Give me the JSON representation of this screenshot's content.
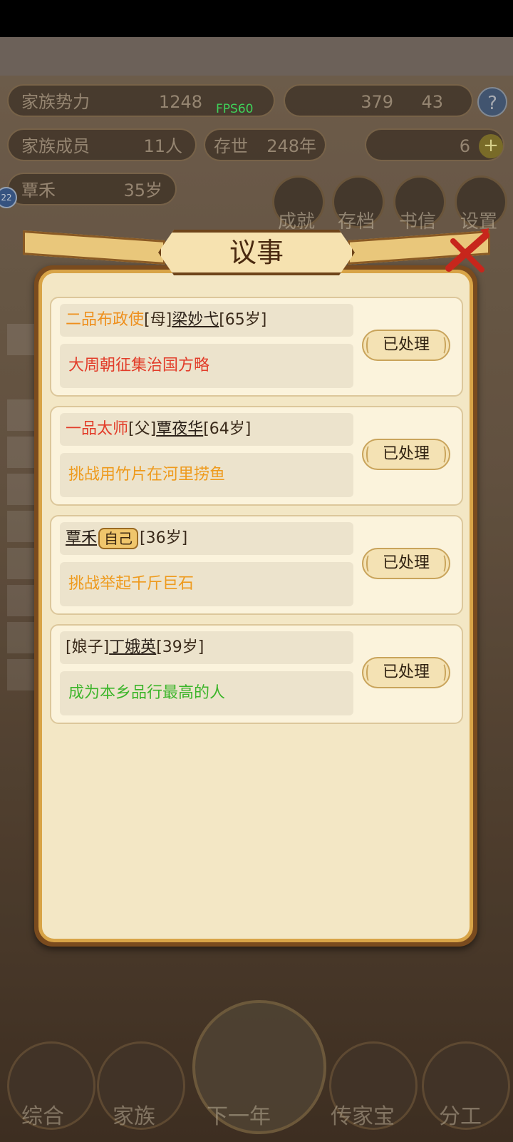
{
  "hud": {
    "clan_power_label": "家族势力",
    "clan_power_value": "1248",
    "resource_a": "379",
    "resource_b": "43",
    "help_label": "?",
    "members_label": "家族成员",
    "members_value": "11人",
    "exist_label": "存世",
    "exist_value": "248年",
    "gold_value": "6",
    "char_name": "覃禾",
    "char_age": "35岁",
    "level_badge": "22",
    "fps": "FPS60"
  },
  "top_menu": [
    {
      "label": "成就"
    },
    {
      "label": "存档"
    },
    {
      "label": "书信"
    },
    {
      "label": "设置"
    }
  ],
  "bottom_nav": {
    "general": "综合",
    "family": "家族",
    "next_year": "下一年",
    "heirloom": "传家宝",
    "division": "分工"
  },
  "dialog": {
    "title": "议事",
    "done_label": "已处理",
    "items": [
      {
        "rank": "二品布政使",
        "relation": "[母]",
        "name": "梁妙弋",
        "age": "[65岁]",
        "task": "大周朝征集治国方略"
      },
      {
        "rank": "一品太师",
        "relation": "[父]",
        "name": "覃夜华",
        "age": "[64岁]",
        "task": "挑战用竹片在河里捞鱼"
      },
      {
        "rank": "",
        "relation": "",
        "name": "覃禾",
        "self_badge": "自己",
        "age": "[36岁]",
        "task": "挑战举起千斤巨石"
      },
      {
        "rank": "",
        "relation": "[娘子]",
        "name": "丁娥英",
        "age": "[39岁]",
        "task": "成为本乡品行最高的人"
      }
    ]
  },
  "colors": {
    "rank_orange": "#ee8f1c",
    "rank_red": "#e23d2a",
    "task_green": "#3cb52a",
    "dialog_bg": "#f3e7c5",
    "dialog_border": "#d8a447"
  }
}
